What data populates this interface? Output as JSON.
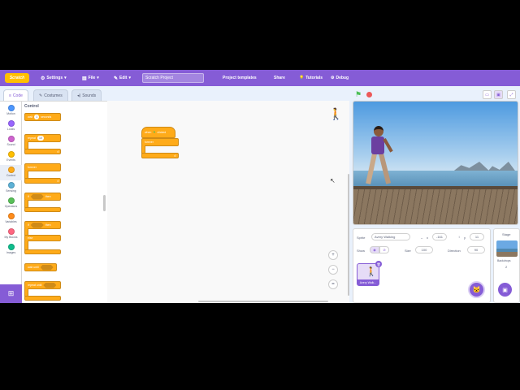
{
  "menubar": {
    "logo": "Scratch",
    "settings": "Settings",
    "file": "File",
    "edit": "Edit",
    "project_title": "Scratch Project",
    "project_templates": "Project templates",
    "share": "Share",
    "tutorials": "Tutorials",
    "debug": "Debug"
  },
  "tabs": {
    "code": "Code",
    "costumes": "Costumes",
    "sounds": "Sounds"
  },
  "categories": [
    {
      "label": "Motion",
      "color": "#4c97ff"
    },
    {
      "label": "Looks",
      "color": "#9966ff"
    },
    {
      "label": "Sound",
      "color": "#cf63cf"
    },
    {
      "label": "Events",
      "color": "#ffbf00"
    },
    {
      "label": "Control",
      "color": "#ffab19"
    },
    {
      "label": "Sensing",
      "color": "#5cb1d6"
    },
    {
      "label": "Operators",
      "color": "#59c059"
    },
    {
      "label": "Variables",
      "color": "#ff8c1a"
    },
    {
      "label": "My Blocks",
      "color": "#ff6680"
    },
    {
      "label": "Images",
      "color": "#0fbd8c"
    }
  ],
  "palette": {
    "title": "Control",
    "wait": "wait",
    "wait_val": "1",
    "seconds": "seconds",
    "repeat": "repeat",
    "repeat_val": "10",
    "forever": "forever",
    "if": "if",
    "then": "then",
    "if2": "if",
    "then2": "then",
    "else": "else",
    "wait_until": "wait until",
    "repeat_until": "repeat until"
  },
  "script": {
    "when_clicked": "when",
    "clicked": "clicked",
    "forever": "forever"
  },
  "sprite_info": {
    "sprite_label": "Sprite",
    "sprite_name": "Avery Walking",
    "x_label": "x",
    "x_val": "-161",
    "y_label": "y",
    "y_val": "11",
    "show_label": "Show",
    "size_label": "Size",
    "size_val": "100",
    "direction_label": "Direction",
    "direction_val": "90",
    "tile_name": "Avery Walk..."
  },
  "stage_panel": {
    "title": "Stage",
    "backdrops_label": "Backdrops",
    "backdrops_count": "2"
  },
  "colors": {
    "accent": "#855cd6",
    "control": "#ffab19"
  }
}
